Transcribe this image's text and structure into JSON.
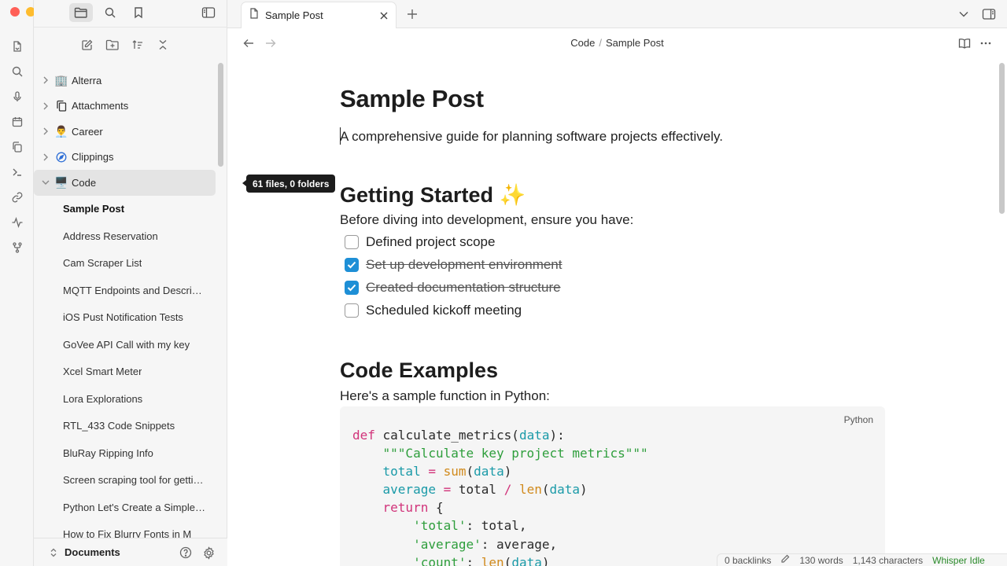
{
  "window": {
    "traffic_colors": [
      "#ff5f57",
      "#febc2e",
      "#28c840"
    ]
  },
  "ribbon": {
    "icons": [
      "file-switch-icon",
      "search-icon",
      "microphone-icon",
      "calendar-icon",
      "copy-icon",
      "terminal-icon",
      "link-icon",
      "activity-icon",
      "git-fork-icon"
    ]
  },
  "sidebar": {
    "folders": [
      {
        "label": "Alterra",
        "icon": "🏢"
      },
      {
        "label": "Attachments",
        "icon": "attachments"
      },
      {
        "label": "Career",
        "icon": "👨‍💼"
      },
      {
        "label": "Clippings",
        "icon": "compass"
      },
      {
        "label": "Code",
        "icon": "🖥️"
      }
    ],
    "files": [
      "Sample Post",
      "Address Reservation",
      "Cam Scraper List",
      "MQTT Endpoints and Descriptions",
      "iOS Pust Notification Tests",
      "GoVee API Call with my key",
      "Xcel Smart Meter",
      "Lora Explorations",
      "RTL_433 Code Snippets",
      "BluRay Ripping Info",
      "Screen scraping tool for getting data",
      "Python Let's Create a Simple App",
      "How to Fix Blurry Fonts in M"
    ],
    "vault_name": "Documents"
  },
  "tooltip": "61 files, 0 folders",
  "tabs": [
    {
      "label": "Sample Post"
    }
  ],
  "breadcrumb": {
    "folder": "Code",
    "sep": "/",
    "file": "Sample Post"
  },
  "doc": {
    "title": "Sample Post",
    "lead": "A comprehensive guide for planning software projects effectively.",
    "getting_started": {
      "heading": "Getting Started ✨",
      "intro": "Before diving into development, ensure you have:",
      "tasks": [
        {
          "text": "Defined project scope",
          "done": false
        },
        {
          "text": "Set up development environment",
          "done": true
        },
        {
          "text": "Created documentation structure",
          "done": true
        },
        {
          "text": "Scheduled kickoff meeting",
          "done": false
        }
      ]
    },
    "code_examples": {
      "heading": "Code Examples",
      "intro": "Here's a sample function in Python:",
      "language": "Python"
    }
  },
  "status": {
    "backlinks": "0 backlinks",
    "words": "130 words",
    "characters": "1,143 characters",
    "plugin": "Whisper Idle"
  }
}
